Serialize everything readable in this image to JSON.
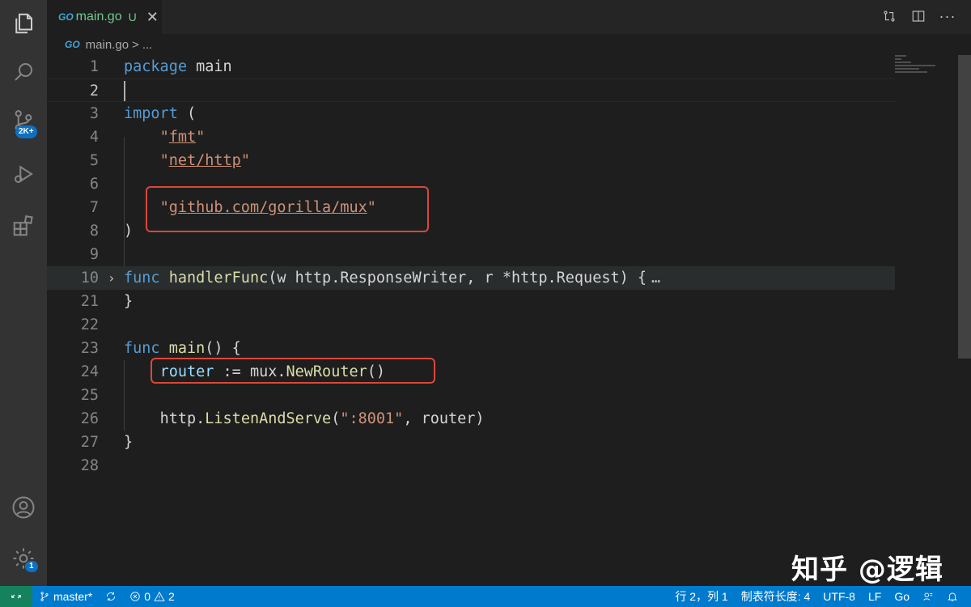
{
  "activity_bar": {
    "scm_badge": "2K+",
    "settings_badge": "1"
  },
  "tab": {
    "name": "main.go",
    "status": "U",
    "close": "✕"
  },
  "breadcrumb": {
    "file": "main.go",
    "separator": ">",
    "more": "..."
  },
  "editor": {
    "lines": [
      {
        "n": "1"
      },
      {
        "n": "2"
      },
      {
        "n": "3"
      },
      {
        "n": "4"
      },
      {
        "n": "5"
      },
      {
        "n": "6"
      },
      {
        "n": "7"
      },
      {
        "n": "8"
      },
      {
        "n": "9"
      },
      {
        "n": "10"
      },
      {
        "n": "21"
      },
      {
        "n": "22"
      },
      {
        "n": "23"
      },
      {
        "n": "24"
      },
      {
        "n": "25"
      },
      {
        "n": "26"
      },
      {
        "n": "27"
      },
      {
        "n": "28"
      }
    ],
    "tokens": {
      "package": "package",
      "main_pkg": " main",
      "import": "import",
      "open_paren": " (",
      "fmt": "fmt",
      "nethttp": "net/http",
      "mux_path": "github.com/gorilla/mux",
      "quote": "\"",
      "close_paren": ")",
      "func": "func",
      "handler_name": "handlerFunc",
      "handler_params": "(w http.ResponseWriter, r *http.Request) {",
      "ellipsis": "…",
      "close_brace": "}",
      "main_name": "main",
      "main_sig": "() {",
      "router": "router",
      "assign": " := mux.",
      "newrouter": "NewRouter",
      "call_parens": "()",
      "http_prefix": "http.",
      "listen": "ListenAndServe",
      "open_call": "(",
      "port": "\":8001\"",
      "listen_args": ", router)"
    }
  },
  "status_bar": {
    "branch": "master*",
    "errors": "0",
    "warnings": "2",
    "position": "行 2，列 1",
    "indent": "制表符长度: 4",
    "encoding": "UTF-8",
    "eol": "LF",
    "language": "Go"
  },
  "watermark": "知乎 @逻辑"
}
